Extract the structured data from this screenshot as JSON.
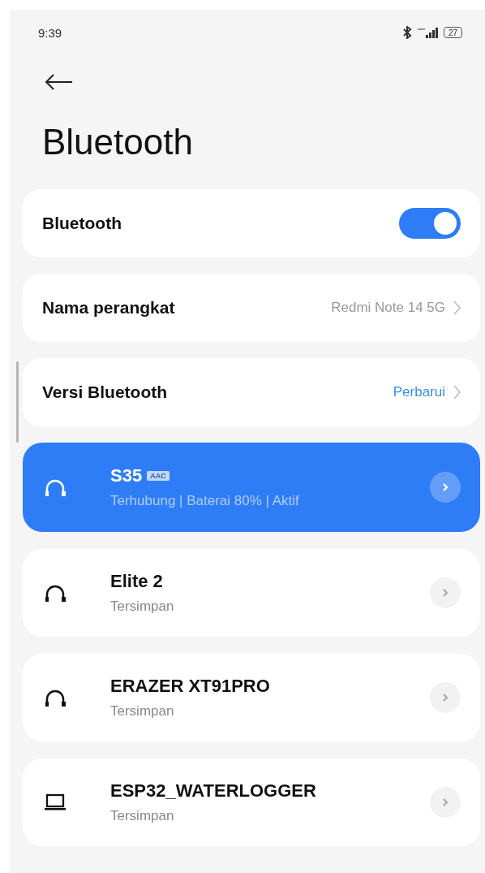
{
  "status_bar": {
    "time": "9:39",
    "battery": "27"
  },
  "title": "Bluetooth",
  "settings": [
    {
      "kind": "toggle",
      "label": "Bluetooth",
      "on": true
    },
    {
      "kind": "link",
      "label": "Nama perangkat",
      "value": "Redmi Note 14 5G",
      "accent": false
    },
    {
      "kind": "link",
      "label": "Versi Bluetooth",
      "value": "Perbarui",
      "accent": true
    }
  ],
  "devices": [
    {
      "kind": "headphones",
      "name": "S35",
      "badge": "AAC",
      "status": "Terhubung | Baterai 80%  | Aktif",
      "selected": true
    },
    {
      "kind": "headphones",
      "name": "Elite 2",
      "status": "Tersimpan",
      "selected": false
    },
    {
      "kind": "headphones",
      "name": "ERAZER XT91PRO",
      "status": "Tersimpan",
      "selected": false
    },
    {
      "kind": "laptop",
      "name": "ESP32_WATERLOGGER",
      "status": "Tersimpan",
      "selected": false
    }
  ]
}
